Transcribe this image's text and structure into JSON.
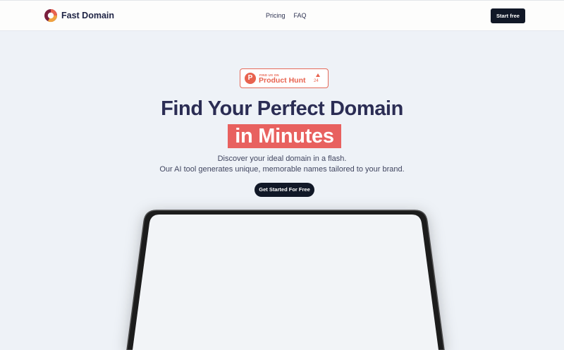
{
  "brand": {
    "name": "Fast Domain",
    "logo_icon": "fast-domain-logo-icon",
    "colors": [
      "#e8634f",
      "#111827",
      "#2b2d54"
    ]
  },
  "nav": {
    "items": [
      "Pricing",
      "FAQ"
    ],
    "cta": "Start free"
  },
  "product_hunt": {
    "small_text": "FIND US ON",
    "name": "Product Hunt",
    "upvote_icon": "upvote-triangle-icon",
    "count": "24",
    "letter": "P"
  },
  "hero": {
    "title_line1": "Find Your Perfect Domain",
    "title_highlight": "in Minutes",
    "subtitle_line1": "Discover your ideal domain in a flash.",
    "subtitle_line2": "Our AI tool generates unique, memorable names tailored to your brand.",
    "cta": "Get Started For Free"
  }
}
